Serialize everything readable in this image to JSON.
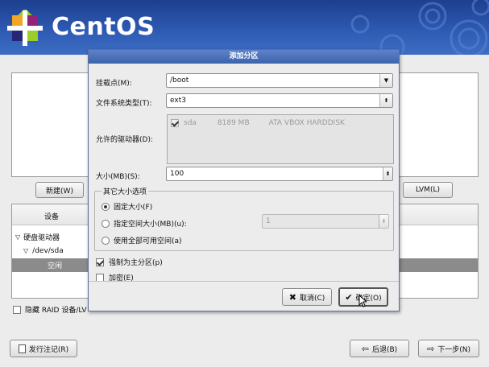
{
  "brand": {
    "name": "CentOS"
  },
  "colors": {
    "banner": "#2f5cb5",
    "dialog_title": "#4a70b9",
    "selected_row": "#8b8b8b"
  },
  "background": {
    "new_button": "新建(W)",
    "lvm_button": "LVM(L)",
    "tree_header_device": "设备",
    "tree": [
      {
        "label": "硬盘驱动器",
        "expanded": true
      },
      {
        "label": "/dev/sda",
        "expanded": true
      },
      {
        "label": "空闲",
        "selected": true
      }
    ],
    "hide_raid_label": "隐藏 RAID 设备/LV",
    "release_notes_button": "发行注记(R)",
    "back_button": "后退(B)",
    "next_button": "下一步(N)"
  },
  "dialog": {
    "title": "添加分区",
    "mount_point_label": "挂载点(M):",
    "mount_point_value": "/boot",
    "fs_type_label": "文件系统类型(T):",
    "fs_type_value": "ext3",
    "drives_label": "允许的驱动器(D):",
    "drive": {
      "name": "sda",
      "size": "8189 MB",
      "model": "ATA VBOX HARDDISK",
      "checked": true
    },
    "size_label": "大小(MB)(S):",
    "size_value": "100",
    "other_size_group": "其它大小选项",
    "opt_fixed": "固定大小(F)",
    "opt_fill_to": "指定空间大小(MB)(u):",
    "opt_fill_to_value": "1",
    "opt_fill_max": "使用全部可用空间(a)",
    "selected_option": "fixed",
    "force_primary_label": "强制为主分区(p)",
    "force_primary_checked": true,
    "encrypt_label": "加密(E)",
    "encrypt_checked": false,
    "cancel_button": "取消(C)",
    "ok_button": "确定(O)"
  }
}
